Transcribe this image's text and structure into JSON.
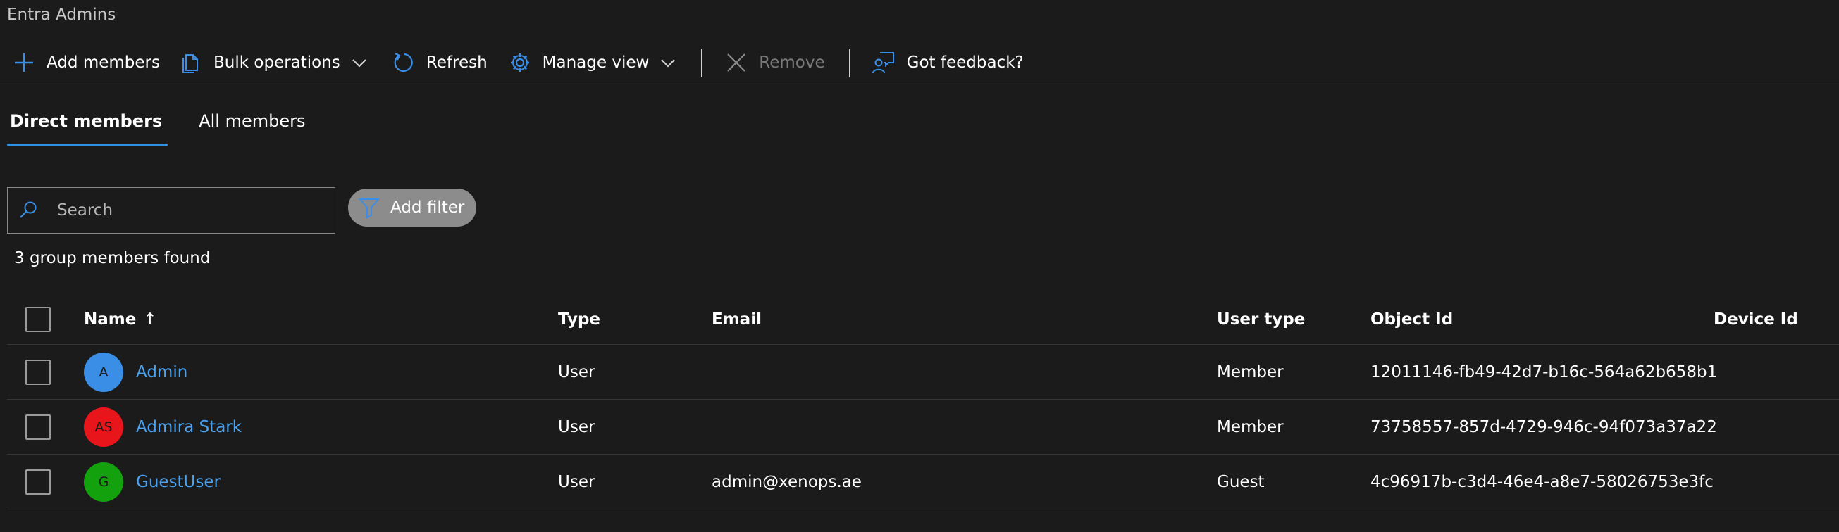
{
  "page": {
    "title": "Entra Admins"
  },
  "toolbar": {
    "add_members": "Add members",
    "bulk_operations": "Bulk operations",
    "refresh": "Refresh",
    "manage_view": "Manage view",
    "remove": "Remove",
    "feedback": "Got feedback?"
  },
  "tabs": [
    {
      "label": "Direct members",
      "active": true
    },
    {
      "label": "All members",
      "active": false
    }
  ],
  "search": {
    "placeholder": "Search",
    "value": ""
  },
  "filter": {
    "label": "Add filter"
  },
  "results": {
    "summary": "3 group members found"
  },
  "table": {
    "columns": {
      "name": "Name",
      "name_sort": "↑",
      "type": "Type",
      "email": "Email",
      "user_type": "User type",
      "object_id": "Object Id",
      "device_id": "Device Id"
    },
    "rows": [
      {
        "initials": "A",
        "avatar_color": "#3a8ee6",
        "name": "Admin",
        "type": "User",
        "email": "",
        "user_type": "Member",
        "object_id": "12011146-fb49-42d7-b16c-564a62b658b1",
        "device_id": ""
      },
      {
        "initials": "AS",
        "avatar_color": "#e8161b",
        "name": "Admira Stark",
        "type": "User",
        "email": "",
        "user_type": "Member",
        "object_id": "73758557-857d-4729-946c-94f073a37a22",
        "device_id": ""
      },
      {
        "initials": "G",
        "avatar_color": "#13a10e",
        "name": "GuestUser",
        "type": "User",
        "email": "admin@xenops.ae",
        "user_type": "Guest",
        "object_id": "4c96917b-c3d4-46e4-a8e7-58026753e3fc",
        "device_id": ""
      }
    ]
  },
  "colors": {
    "accent": "#2f8fe0",
    "link": "#4aa3f0",
    "background": "#1b1b1b",
    "icon_blue": "#3a8ee6"
  },
  "icons": {
    "add": "plus-icon",
    "bulk": "document-stack-icon",
    "refresh": "refresh-icon",
    "manage": "gear-icon",
    "remove": "close-icon",
    "feedback": "feedback-person-icon",
    "search": "search-icon",
    "filter": "filter-funnel-icon"
  }
}
